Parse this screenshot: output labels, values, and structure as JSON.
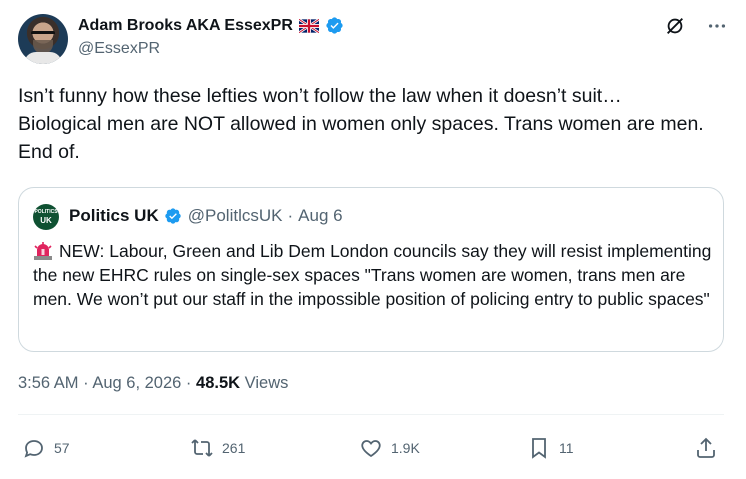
{
  "author": {
    "display_name": "Adam Brooks AKA EssexPR",
    "handle": "@EssexPR",
    "flag": "uk-flag",
    "verified": true
  },
  "tweet": {
    "text": "Isn’t funny how these lefties won’t follow the law when it doesn’t suit…\nBiological men are NOT allowed in women only spaces.  Trans women are men. End of."
  },
  "quote": {
    "avatar_text_top": "POLITICS",
    "avatar_text_bottom": "UK",
    "name": "Politics UK",
    "handle": "@PolitlcsUK",
    "separator": "·",
    "date": "Aug 6",
    "icon": "siren-icon",
    "text": "NEW: Labour, Green and Lib Dem London councils say they will resist implementing the new EHRC rules on single-sex spaces \"Trans women are women, trans men are men. We won’t put our staff in the impossible position of policing entry to public spaces\""
  },
  "meta": {
    "time": "3:56 AM",
    "sep1": "·",
    "date": "Aug 6, 2026",
    "sep2": "·",
    "views_count": "48.5K",
    "views_label": "Views"
  },
  "actions": {
    "replies": "57",
    "reposts": "261",
    "likes": "1.9K",
    "bookmarks": "11"
  },
  "colors": {
    "text": "#0f1419",
    "secondary": "#536471",
    "border": "#cfd9de",
    "verified": "#1d9bf0"
  }
}
